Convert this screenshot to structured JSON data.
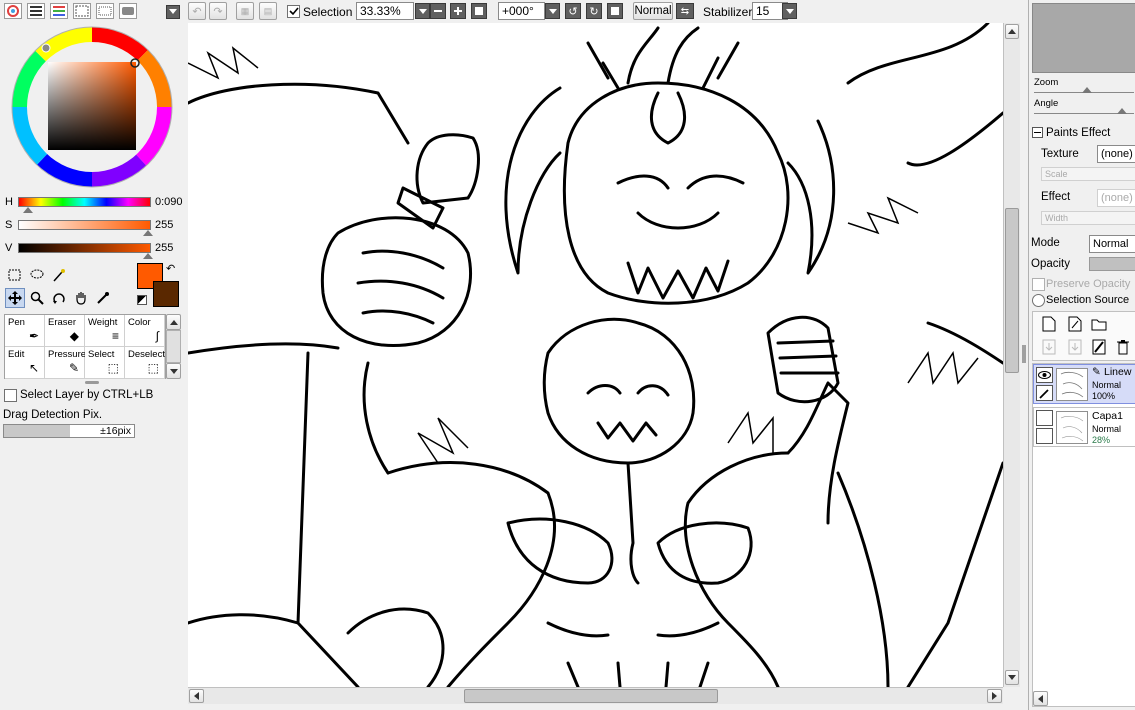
{
  "color_panel": {
    "h_label": "H",
    "h_value": "0:090",
    "s_label": "S",
    "s_value": "255",
    "v_label": "V",
    "v_value": "255",
    "fg_color": "#ff5a00",
    "bg_color": "#5a2800"
  },
  "brush_tools": [
    {
      "label": "Pen",
      "icon": "pen-icon"
    },
    {
      "label": "Eraser",
      "icon": "eraser-icon"
    },
    {
      "label": "Weight",
      "icon": "weight-icon"
    },
    {
      "label": "Color",
      "icon": "color-icon"
    },
    {
      "label": "Edit",
      "icon": "edit-icon"
    },
    {
      "label": "Pressure",
      "icon": "pressure-icon"
    },
    {
      "label": "Select",
      "icon": "select-icon"
    },
    {
      "label": "Deselect",
      "icon": "deselect-icon"
    }
  ],
  "options": {
    "select_layer_label": "Select Layer by CTRL+LB",
    "drag_detection_label": "Drag Detection Pix.",
    "drag_detection_value": "±16pix"
  },
  "toolbar": {
    "selection_label": "Selection",
    "zoom_value": "33.33%",
    "rotation_value": "+000°",
    "blend_mode": "Normal",
    "stabilizer_label": "Stabilizer",
    "stabilizer_value": "15"
  },
  "navigator": {
    "zoom_label": "Zoom",
    "angle_label": "Angle"
  },
  "layer_props": {
    "paints_effect_label": "Paints Effect",
    "texture_label": "Texture",
    "texture_value": "(none)",
    "scale_label": "Scale",
    "effect_label": "Effect",
    "effect_value": "(none)",
    "width_label": "Width",
    "mode_label": "Mode",
    "mode_value": "Normal",
    "opacity_label": "Opacity",
    "preserve_opacity_label": "Preserve Opacity",
    "selection_source_label": "Selection Source"
  },
  "layers": [
    {
      "name": "Linew",
      "mode": "Normal",
      "opacity": "100%"
    },
    {
      "name": "Capa1",
      "mode": "Normal",
      "opacity": "28%"
    }
  ]
}
